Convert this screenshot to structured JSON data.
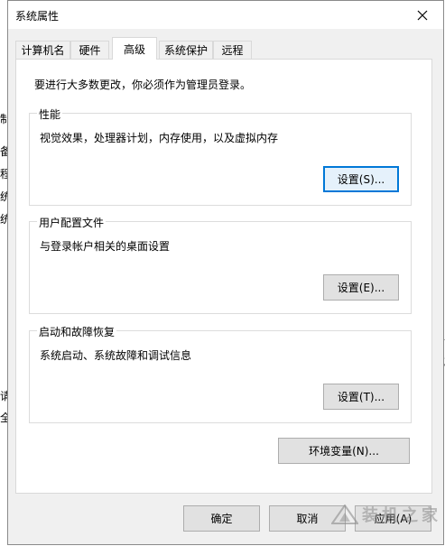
{
  "window": {
    "title": "系统属性",
    "close_glyph": "✕"
  },
  "tabs": [
    {
      "label": "计算机名"
    },
    {
      "label": "硬件"
    },
    {
      "label": "高级",
      "active": true
    },
    {
      "label": "系统保护"
    },
    {
      "label": "远程"
    }
  ],
  "panel": {
    "notice": "要进行大多数更改，你必须作为管理员登录。",
    "performance": {
      "legend": "性能",
      "description": "视觉效果，处理器计划，内存使用，以及虚拟内存",
      "button": "设置(S)..."
    },
    "user_profiles": {
      "legend": "用户配置文件",
      "description": "与登录帐户相关的桌面设置",
      "button": "设置(E)..."
    },
    "startup_recovery": {
      "legend": "启动和故障恢复",
      "description": "系统启动、系统故障和调试信息",
      "button": "设置(T)..."
    }
  },
  "env_button": "环境变量(N)...",
  "footer": {
    "ok": "确定",
    "cancel": "取消",
    "apply": "应用(A)"
  },
  "background_fragments": {
    "left": [
      "制",
      "备",
      "程",
      "统",
      "统",
      "请",
      "全"
    ],
    "right": [
      "9(",
      "4",
      "或"
    ]
  },
  "watermark": {
    "text": "装机之家"
  },
  "colors": {
    "dialog_bg": "#f0f0f0",
    "panel_bg": "#ffffff",
    "default_button_border": "#0078d7",
    "button_bg": "#e1e1e1"
  }
}
